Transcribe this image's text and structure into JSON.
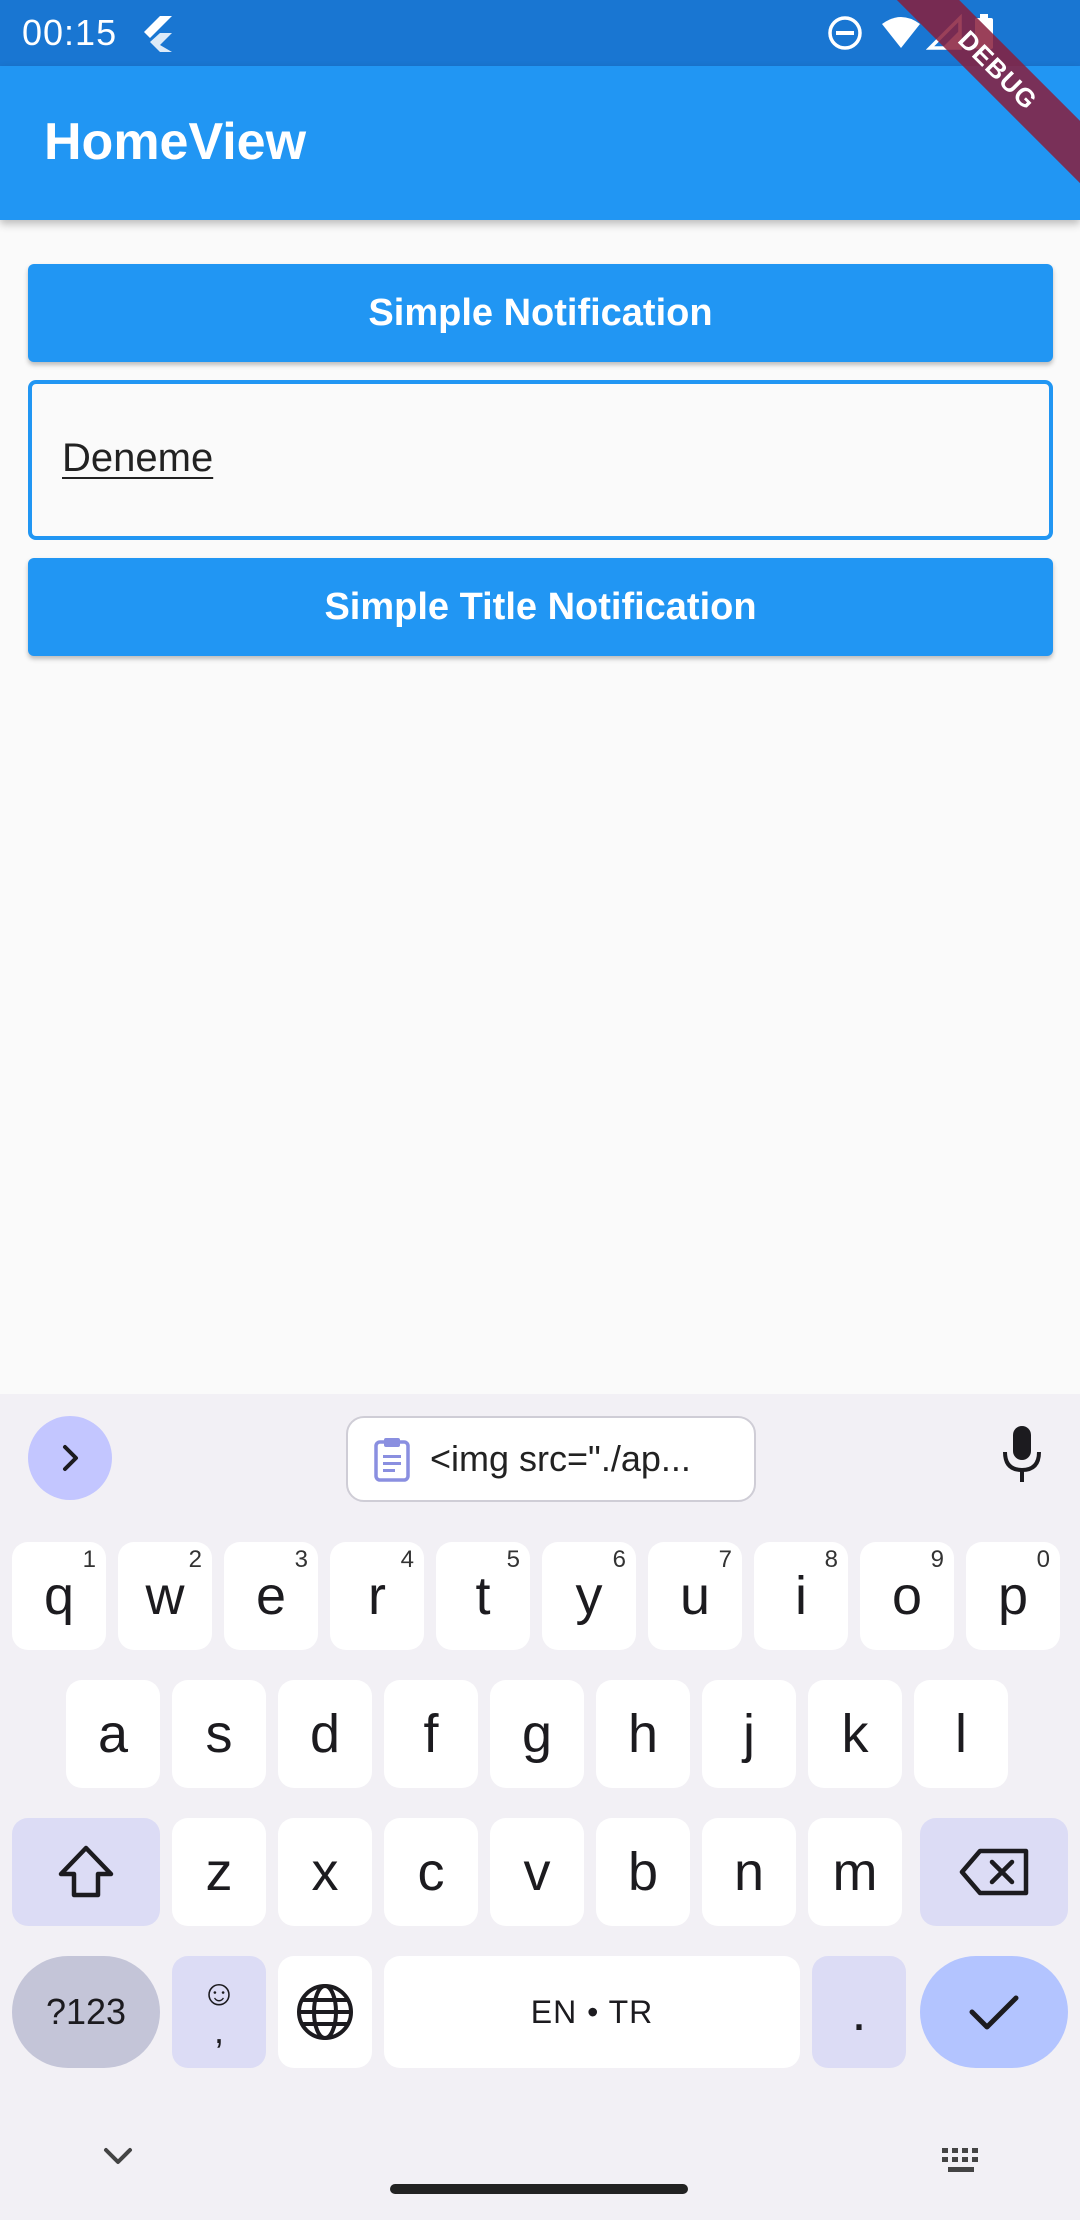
{
  "status_bar": {
    "time": "00:15",
    "icons": [
      "flutter-icon",
      "do-not-disturb-icon",
      "wifi-icon",
      "signal-icon",
      "battery-icon"
    ]
  },
  "app_bar": {
    "title": "HomeView"
  },
  "debug_banner": {
    "label": "DEBUG"
  },
  "content": {
    "simple_notification_label": "Simple Notification",
    "text_field_value": "Deneme",
    "simple_title_notification_label": "Simple Title Notification"
  },
  "keyboard": {
    "clipboard_suggestion": "<img src=\"./ap...",
    "row1": [
      {
        "key": "q",
        "hint": "1"
      },
      {
        "key": "w",
        "hint": "2"
      },
      {
        "key": "e",
        "hint": "3"
      },
      {
        "key": "r",
        "hint": "4"
      },
      {
        "key": "t",
        "hint": "5"
      },
      {
        "key": "y",
        "hint": "6"
      },
      {
        "key": "u",
        "hint": "7"
      },
      {
        "key": "i",
        "hint": "8"
      },
      {
        "key": "o",
        "hint": "9"
      },
      {
        "key": "p",
        "hint": "0"
      }
    ],
    "row2": [
      "a",
      "s",
      "d",
      "f",
      "g",
      "h",
      "j",
      "k",
      "l"
    ],
    "row3": [
      "z",
      "x",
      "c",
      "v",
      "b",
      "n",
      "m"
    ],
    "symbols_label": "?123",
    "emoji_top": "☺",
    "emoji_bottom": ",",
    "space_label": "EN • TR",
    "period_label": "."
  },
  "colors": {
    "status_bar": "#1976d2",
    "app_bar": "#2196f3",
    "button": "#2196f3",
    "keyboard_bg": "#f2f0f5",
    "enter_key": "#b3c4ff"
  }
}
